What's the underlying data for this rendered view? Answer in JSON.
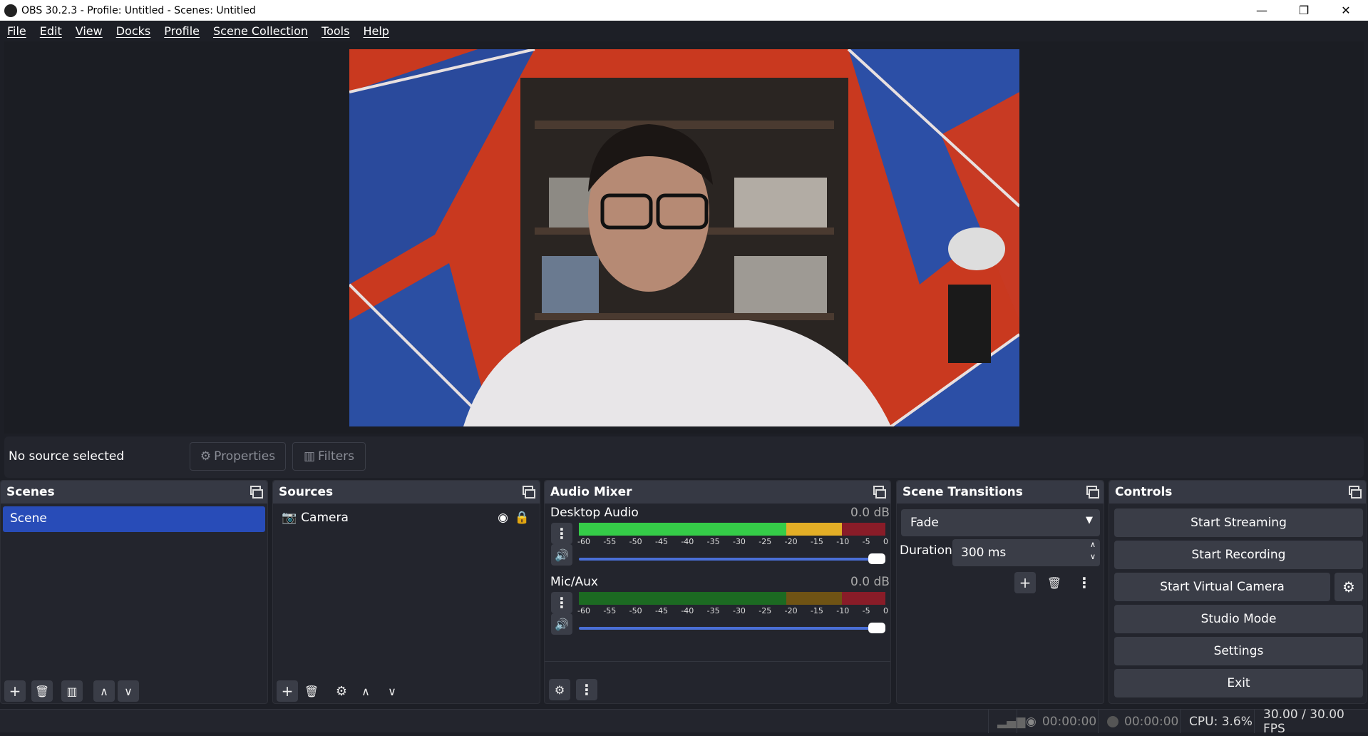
{
  "window": {
    "title": "OBS 30.2.3 - Profile: Untitled - Scenes: Untitled",
    "minimize": "—",
    "restore": "❐",
    "close": "✕"
  },
  "menu": [
    "File",
    "Edit",
    "View",
    "Docks",
    "Profile",
    "Scene Collection",
    "Tools",
    "Help"
  ],
  "source_toolbar": {
    "status": "No source selected",
    "properties": "Properties",
    "filters": "Filters"
  },
  "scenes": {
    "title": "Scenes",
    "items": [
      "Scene"
    ]
  },
  "sources": {
    "title": "Sources",
    "items": [
      "Camera"
    ]
  },
  "audio_mixer": {
    "title": "Audio Mixer",
    "channels": [
      {
        "name": "Desktop Audio",
        "level": "0.0 dB",
        "volume": 1.0
      },
      {
        "name": "Mic/Aux",
        "level": "0.0 dB",
        "volume": 1.0
      }
    ],
    "ticks": [
      "-60",
      "-55",
      "-50",
      "-45",
      "-40",
      "-35",
      "-30",
      "-25",
      "-20",
      "-15",
      "-10",
      "-5",
      "0"
    ]
  },
  "transitions": {
    "title": "Scene Transitions",
    "selected": "Fade",
    "duration_label": "Duration",
    "duration": "300 ms"
  },
  "controls": {
    "title": "Controls",
    "buttons": [
      "Start Streaming",
      "Start Recording",
      "Start Virtual Camera",
      "Studio Mode",
      "Settings",
      "Exit"
    ]
  },
  "status": {
    "stream_time": "00:00:00",
    "rec_time": "00:00:00",
    "cpu": "CPU: 3.6%",
    "fps": "30.00 / 30.00 FPS"
  },
  "colors": {
    "selected": "#284cb8",
    "meter_green": "#35cc48",
    "meter_yellow": "#e3ae26",
    "meter_red": "#891c28"
  }
}
